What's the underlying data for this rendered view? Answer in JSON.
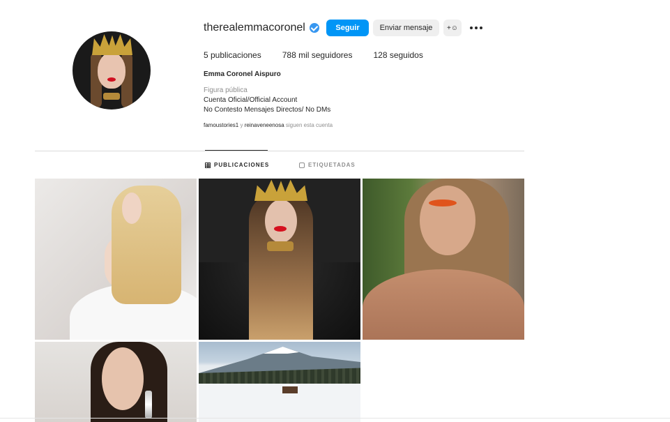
{
  "profile": {
    "username": "therealemmacoronel",
    "verified": true,
    "follow_label": "Seguir",
    "message_label": "Enviar mensaje",
    "suggest_label": "+☺",
    "more_icon": "more-horizontal-icon",
    "stats": {
      "posts": "5 publicaciones",
      "followers": "788 mil seguidores",
      "following": "128 seguidos"
    },
    "full_name": "Emma Coronel Aispuro",
    "category": "Figura pública",
    "bio_line1": "Cuenta Oficial/Official Account",
    "bio_line2": "No Contesto Mensajes Directos/ No DMs",
    "followed_by": {
      "user1": "famoustories1",
      "connector": " y ",
      "user2": "reinaveneenosa",
      "suffix": " siguen esta cuenta"
    }
  },
  "tabs": [
    {
      "label": "PUBLICACIONES",
      "icon": "grid-icon",
      "active": true
    },
    {
      "label": "ETIQUETADAS",
      "icon": "tagged-icon",
      "active": false
    }
  ],
  "colors": {
    "accent": "#0095f6",
    "verified": "#3897f0",
    "text": "#262626",
    "secondary": "#8e8e8e"
  }
}
